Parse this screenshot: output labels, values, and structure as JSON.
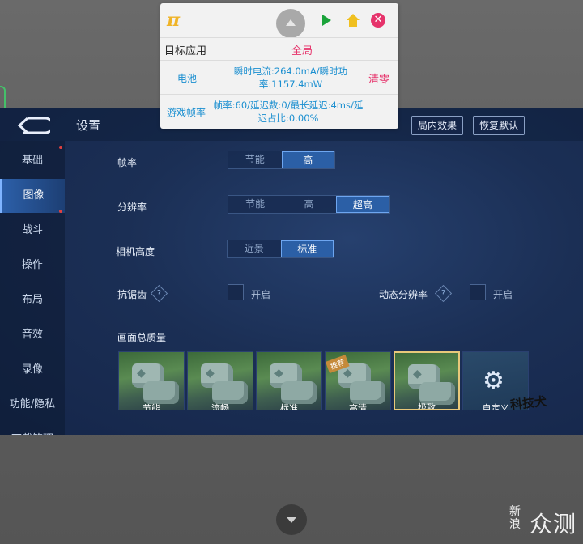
{
  "overlay": {
    "logo": "π",
    "target_label": "目标应用",
    "target_value": "全局",
    "battery_label": "电池",
    "battery_text": "瞬时电流:264.0mA/瞬时功率:1157.4mW",
    "clear_label": "清零",
    "fps_label": "游戏帧率",
    "fps_text": "帧率:60/延迟数:0/最长延迟:4ms/延迟占比:0.00%"
  },
  "game": {
    "title": "设置",
    "btn_effect": "局内效果",
    "btn_reset": "恢复默认",
    "sidebar": [
      {
        "label": "基础",
        "active": false
      },
      {
        "label": "图像",
        "active": true
      },
      {
        "label": "战斗",
        "active": false
      },
      {
        "label": "操作",
        "active": false
      },
      {
        "label": "布局",
        "active": false
      },
      {
        "label": "音效",
        "active": false
      },
      {
        "label": "录像",
        "active": false
      },
      {
        "label": "功能/隐私",
        "active": false
      },
      {
        "label": "下载管理",
        "active": false
      }
    ],
    "framerate": {
      "label": "帧率",
      "options": [
        "节能",
        "高"
      ],
      "selected": "高"
    },
    "resolution": {
      "label": "分辨率",
      "options": [
        "节能",
        "高",
        "超高"
      ],
      "selected": "超高"
    },
    "camera": {
      "label": "相机高度",
      "options": [
        "近景",
        "标准"
      ],
      "selected": "标准"
    },
    "antialias": {
      "label": "抗锯齿",
      "help": "?",
      "toggle": "开启",
      "checked": false
    },
    "dynres": {
      "label": "动态分辨率",
      "help": "?",
      "toggle": "开启",
      "checked": false
    },
    "quality": {
      "label": "画面总质量",
      "presets": [
        {
          "label": "节能",
          "badge": "",
          "selected": false
        },
        {
          "label": "流畅",
          "badge": "",
          "selected": false
        },
        {
          "label": "标准",
          "badge": "",
          "selected": false
        },
        {
          "label": "高清",
          "badge": "推荐",
          "selected": false
        },
        {
          "label": "极致",
          "badge": "",
          "selected": true
        },
        {
          "label": "自定义",
          "badge": "",
          "selected": false
        }
      ]
    }
  },
  "watermark": {
    "mascot_text": "科技犬",
    "sina": "新浪",
    "zhong": "众测"
  },
  "colors": {
    "overlay_blue": "#1b8fd0",
    "overlay_pink": "#e6336b",
    "game_bg": "#1b2f55",
    "accent_selected": "#2b5fa6"
  }
}
